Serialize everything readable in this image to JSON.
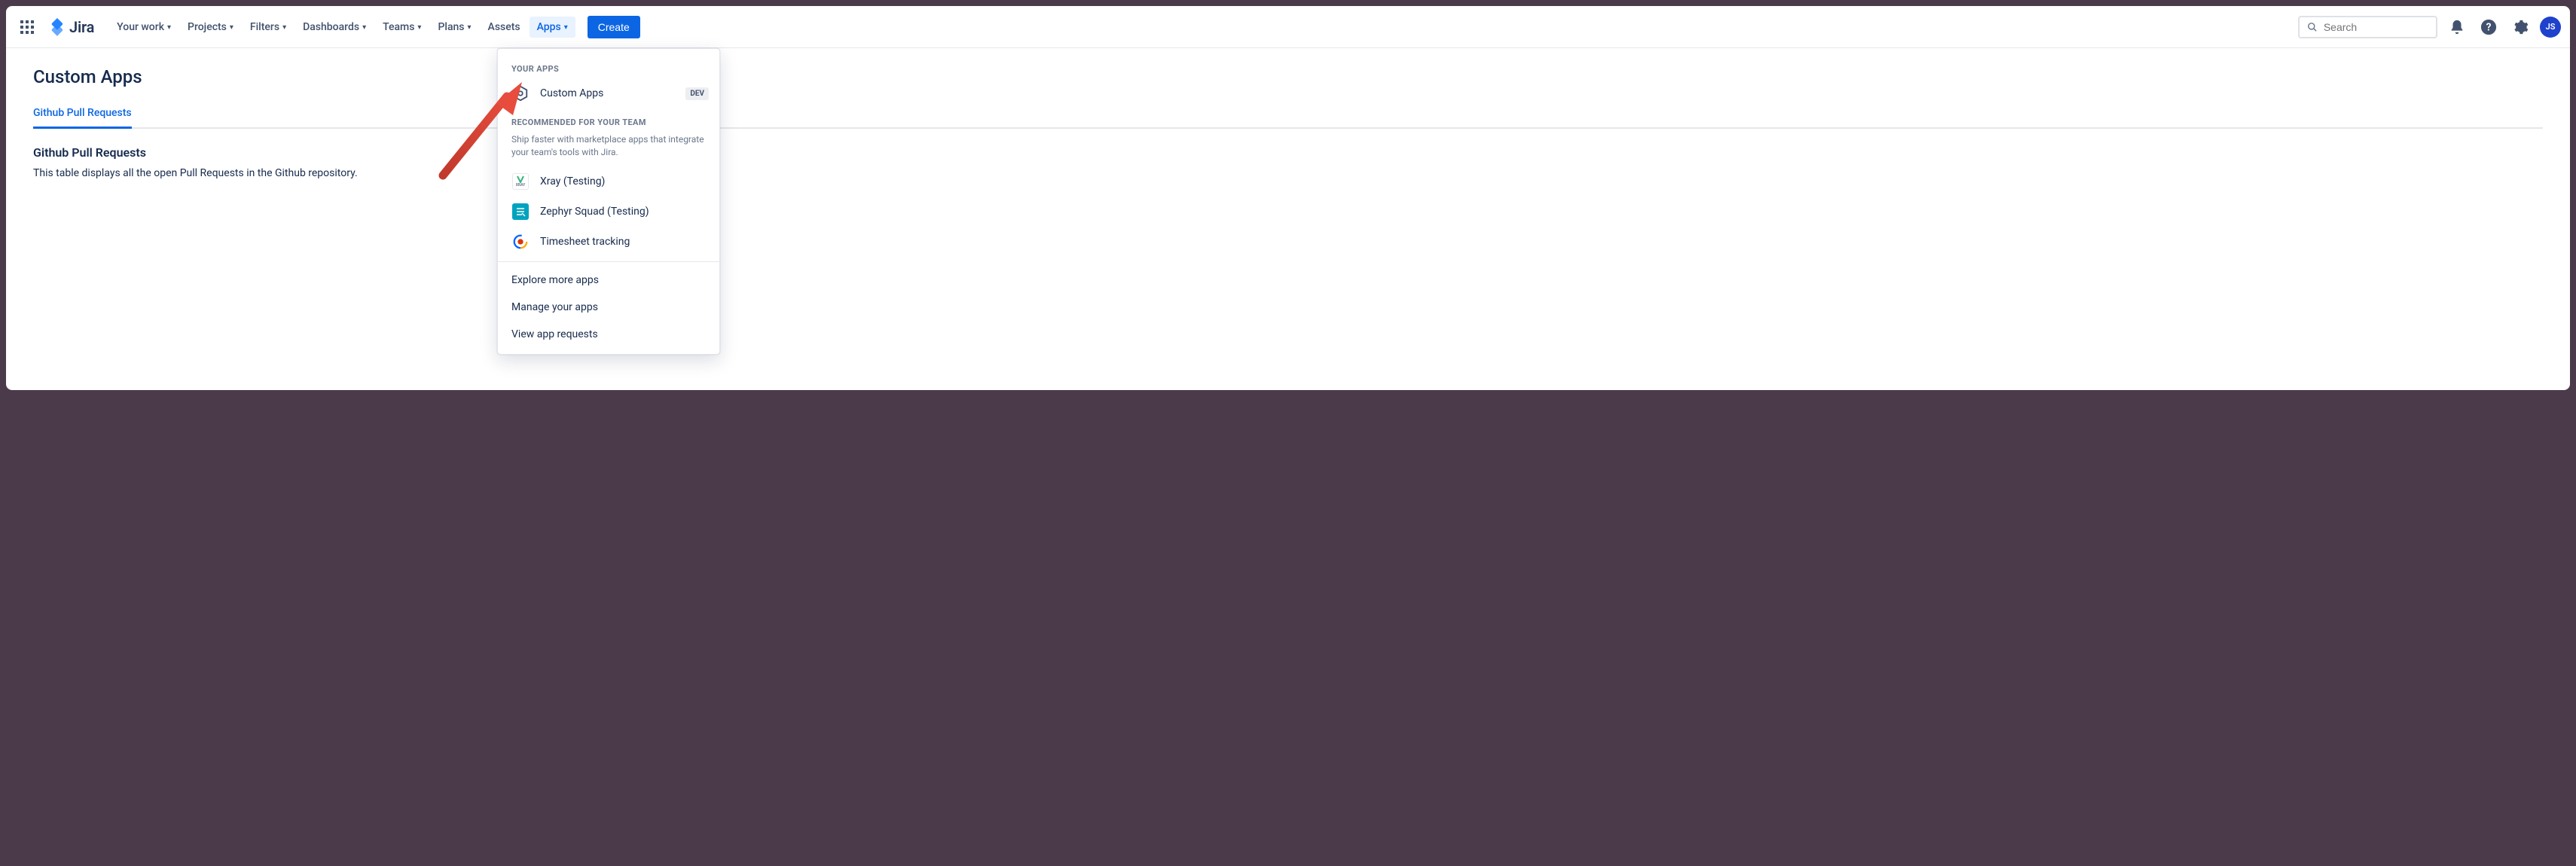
{
  "brand": "Jira",
  "nav": {
    "your_work": "Your work",
    "projects": "Projects",
    "filters": "Filters",
    "dashboards": "Dashboards",
    "teams": "Teams",
    "plans": "Plans",
    "assets": "Assets",
    "apps": "Apps",
    "create": "Create"
  },
  "search": {
    "placeholder": "Search"
  },
  "avatar_initials": "JS",
  "page": {
    "title": "Custom Apps",
    "tab": "Github Pull Requests",
    "section_heading": "Github Pull Requests",
    "section_desc": "This table displays all the open Pull Requests in the Github repository."
  },
  "dropdown": {
    "your_apps_label": "YOUR APPS",
    "custom_apps": "Custom Apps",
    "dev_badge": "DEV",
    "recommended_label": "RECOMMENDED FOR YOUR TEAM",
    "recommended_desc": "Ship faster with marketplace apps that integrate your team's tools with Jira.",
    "xray": "Xray (Testing)",
    "xray_icon_label": "XRAY",
    "zephyr": "Zephyr Squad (Testing)",
    "timesheet": "Timesheet tracking",
    "explore": "Explore more apps",
    "manage": "Manage your apps",
    "view_requests": "View app requests"
  }
}
